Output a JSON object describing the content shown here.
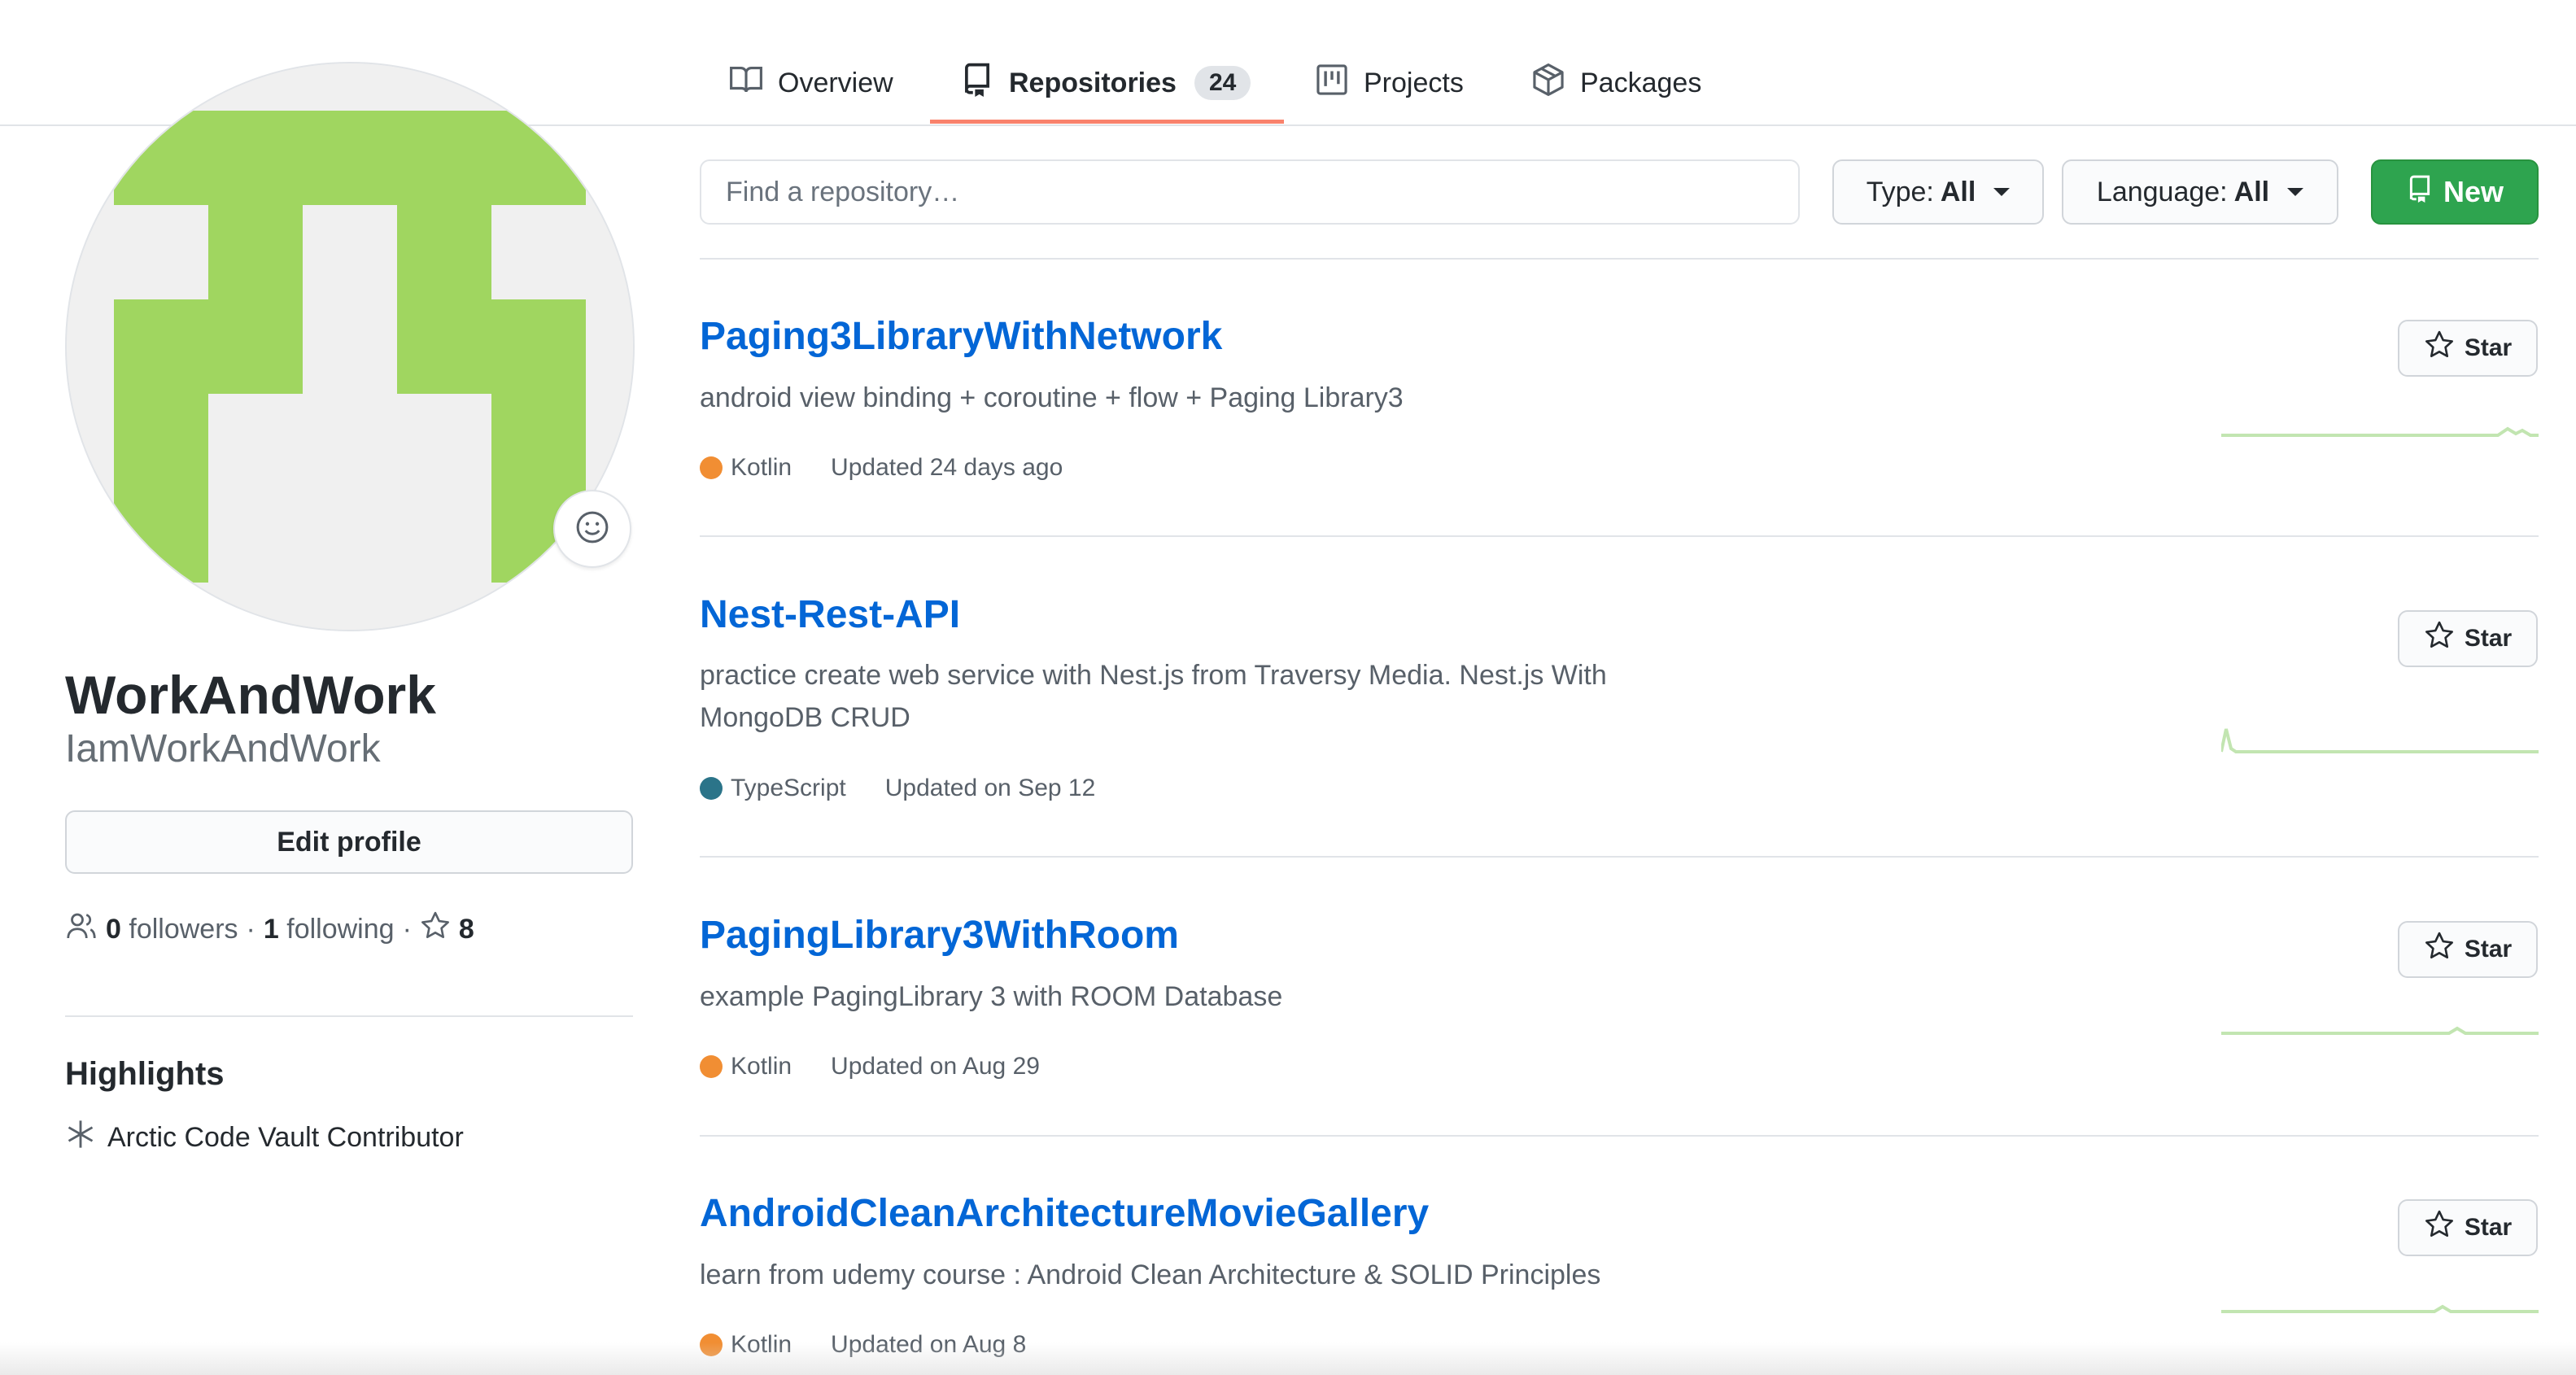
{
  "tabs": [
    {
      "label": "Overview",
      "icon": "book-icon"
    },
    {
      "label": "Repositories",
      "icon": "repo-icon",
      "count": "24"
    },
    {
      "label": "Projects",
      "icon": "project-icon"
    },
    {
      "label": "Packages",
      "icon": "package-icon"
    }
  ],
  "profile": {
    "fullname": "WorkAndWork",
    "username": "IamWorkAndWork",
    "edit_label": "Edit profile",
    "followers_count": "0",
    "followers_label": "followers",
    "sep": "·",
    "following_count": "1",
    "following_label": "following",
    "stars_count": "8",
    "avatar_color": "#a0d660"
  },
  "highlights": {
    "title": "Highlights",
    "items": [
      "Arctic Code Vault Contributor"
    ]
  },
  "filters": {
    "search_placeholder": "Find a repository…",
    "type_label": "Type:",
    "type_value": "All",
    "language_label": "Language:",
    "language_value": "All",
    "new_label": "New"
  },
  "repos": [
    {
      "name": "Paging3LibraryWithNetwork",
      "description": "android view binding + coroutine + flow + Paging Library3",
      "language": "Kotlin",
      "language_color": "#F18E33",
      "updated": "Updated 24 days ago",
      "star_label": "Star"
    },
    {
      "name": "Nest-Rest-API",
      "description": "practice create web service with Nest.js from Traversy Media. Nest.js With MongoDB CRUD",
      "language": "TypeScript",
      "language_color": "#2b7489",
      "updated": "Updated on Sep 12",
      "star_label": "Star"
    },
    {
      "name": "PagingLibrary3WithRoom",
      "description": "example PagingLibrary 3 with ROOM Database",
      "language": "Kotlin",
      "language_color": "#F18E33",
      "updated": "Updated on Aug 29",
      "star_label": "Star"
    },
    {
      "name": "AndroidCleanArchitectureMovieGallery",
      "description": "learn from udemy course : Android Clean Architecture & SOLID Principles",
      "language": "Kotlin",
      "language_color": "#F18E33",
      "updated": "Updated on Aug 8",
      "star_label": "Star"
    }
  ],
  "colors": {
    "link": "#0366d6",
    "new_button": "#2ea44f",
    "tab_underline": "#f9826c",
    "sparkline": "#c2e5b1"
  }
}
